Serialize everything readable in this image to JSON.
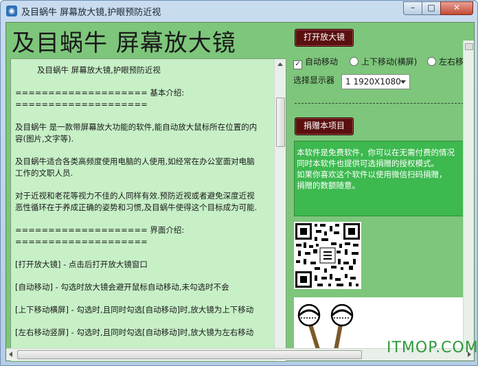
{
  "window": {
    "title": "及目蜗牛 屏幕放大镜,护眼预防近视",
    "minimize_symbol": "–",
    "maximize_symbol": "□",
    "close_symbol": "✕"
  },
  "header": {
    "app_title": "及目蜗牛  屏幕放大镜"
  },
  "description": {
    "lines": [
      "及目蜗牛 屏幕放大镜,护眼预防近视",
      "==================== 基本介绍:",
      "====================",
      "及目蜗牛 是一款带屏幕放大功能的软件,能自动放大鼠标所在位置的内",
      "容(图片,文字等).",
      "及目蜗牛适合各类高频度使用电脑的人使用,如经常在办公室面对电脑",
      "工作的文职人员.",
      "对于近视和老花等视力不佳的人同样有效.预防近视或者避免深度近视",
      "恶性循环在于养成正确的姿势和习惯,及目蜗牛使得这个目标成为可能.",
      "==================== 界面介绍:",
      "====================",
      "[打开放大镜]   - 点击后打开放大镜窗口",
      "[自动移动]      - 勾选时放大镜会避开鼠标自动移动,未勾选时不会",
      "[上下移动横屏] - 勾选时,且同时勾选[自动移动]时,放大镜为上下移动",
      "[左右移动竖屏] - 勾选时,且同时勾选[自动移动]时,放大镜为左右移动"
    ]
  },
  "controls": {
    "open_button_label": "打开放大镜",
    "auto_move_label": "自动移动",
    "auto_move_checked": true,
    "up_down_label": "上下移动(横屏)",
    "left_right_label": "左右移",
    "display_label": "选择显示器",
    "display_value": "1 1920X1080",
    "donate_button_label": "捐赠本项目"
  },
  "info": {
    "lines": [
      "本软件是免费软件，你可以在无需付费的情况",
      "同时本软件也提供可选捐赠的授权模式。",
      "如果你喜欢这个软件以使用微信扫码捐赠，",
      "捐赠的数额随意。"
    ]
  },
  "watermark": "ITMOP.COM",
  "colors": {
    "panel_green": "#7dc67b",
    "text_area_bg": "#c7f0c7",
    "button_dark_red": "#5b1010",
    "info_green": "#3db94f"
  }
}
